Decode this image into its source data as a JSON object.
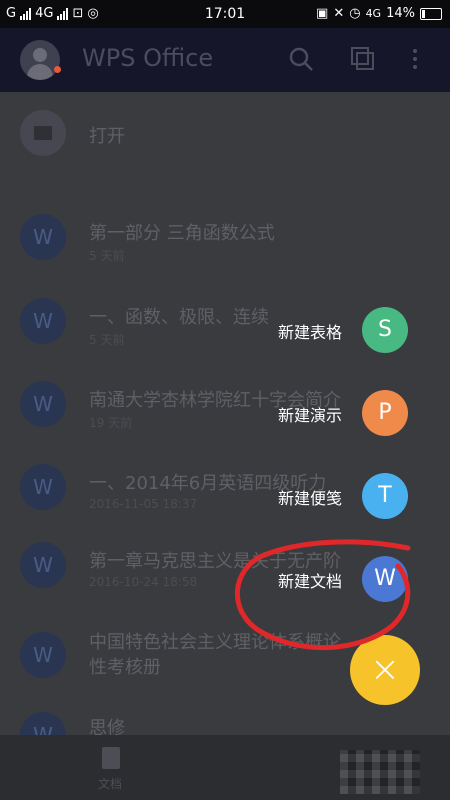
{
  "status_bar": {
    "carrier": "G",
    "network": "4G",
    "time": "17:01",
    "network_right": "4G",
    "battery": "14%"
  },
  "app_bar": {
    "title": "WPS Office",
    "icons": [
      "search-icon",
      "multi-window-icon",
      "more-vert-icon"
    ]
  },
  "open_item": {
    "label": "打开"
  },
  "recent_files": [
    {
      "name": "第一部分 三角函数公式",
      "meta": "5 天前"
    },
    {
      "name": "一、函数、极限、连续",
      "meta": "5 天前"
    },
    {
      "name": "南通大学杏林学院红十字会简介",
      "meta": "19 天前"
    },
    {
      "name": "一、2014年6月英语四级听力",
      "meta": "2016-11-05 18:37"
    },
    {
      "name": "第一章马克思主义是关于无产阶",
      "meta": "2016-10-24 18:58"
    },
    {
      "name": "中国特色社会主义理论体系概论\n性考核册",
      "meta": ""
    },
    {
      "name": "思修",
      "meta": ""
    }
  ],
  "fab_menu": [
    {
      "label": "新建表格",
      "letter": "S",
      "color": "#48b982"
    },
    {
      "label": "新建演示",
      "letter": "P",
      "color": "#f08a4b"
    },
    {
      "label": "新建便笺",
      "letter": "T",
      "color": "#49b1f0"
    },
    {
      "label": "新建文档",
      "letter": "W",
      "color": "#4b78d2"
    }
  ],
  "fab_close": {
    "symbol": "×",
    "color": "#f6c32a"
  },
  "bottom_nav": {
    "doc_label": "文档"
  }
}
